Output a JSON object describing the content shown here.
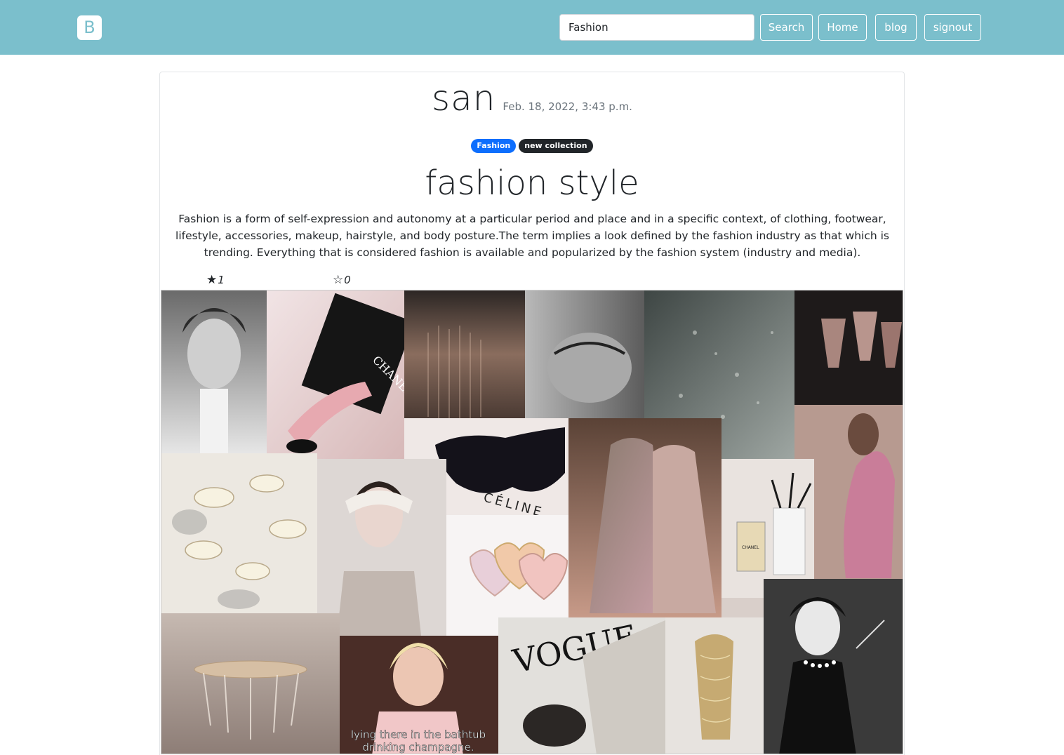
{
  "navbar": {
    "brand_letter": "B",
    "search_value": "Fashion",
    "search_label": "Search",
    "home_label": "Home",
    "blog_label": "blog",
    "signout_label": "signout"
  },
  "post": {
    "author": "san",
    "date": "Feb. 18, 2022, 3:43 p.m.",
    "tags": [
      "Fashion",
      "new collection"
    ],
    "title": "fashion style",
    "body": "Fashion is a form of self-expression and autonomy at a particular period and place and in a specific context, of clothing, footwear, lifestyle, accessories, makeup, hairstyle, and body posture.The term implies a look defined by the fashion industry as that which is trending. Everything that is considered fashion is available and popularized by the fashion system (industry and media).",
    "likes": "1",
    "dislikes": "0",
    "image_caption_lines": [
      "lying there in the bathtub",
      "drinking champagne."
    ],
    "image_text": [
      "CHANEL",
      "CÉLINE",
      "VOGUE",
      "CHANEL"
    ]
  }
}
